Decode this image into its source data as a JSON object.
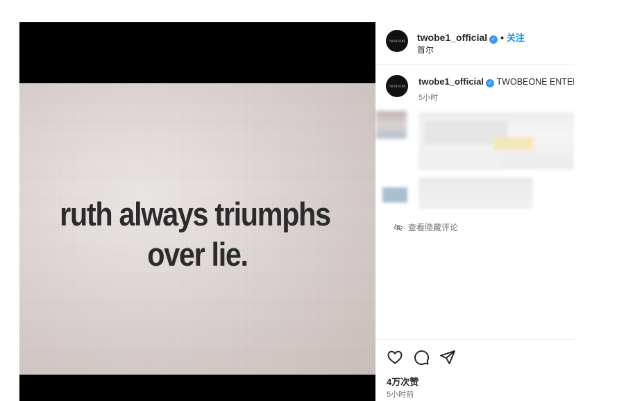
{
  "post_image": {
    "quote_line1": "ruth always triumphs",
    "quote_line2": "over lie."
  },
  "header": {
    "username": "twobe1_official",
    "separator": "•",
    "follow_label": "关注",
    "location": "首尔",
    "avatar_text": "TWOBEONE"
  },
  "caption": {
    "username": "twobe1_official",
    "text": "TWOBEONE ENTERTAINMENT",
    "time": "5小时"
  },
  "hidden_comments_label": "查看隐藏评论",
  "likes": "4万次赞",
  "post_time": "5小时前",
  "colors": {
    "accent": "#0095f6",
    "verified": "#3897f0",
    "text": "#262626",
    "secondary_text": "#737373"
  }
}
